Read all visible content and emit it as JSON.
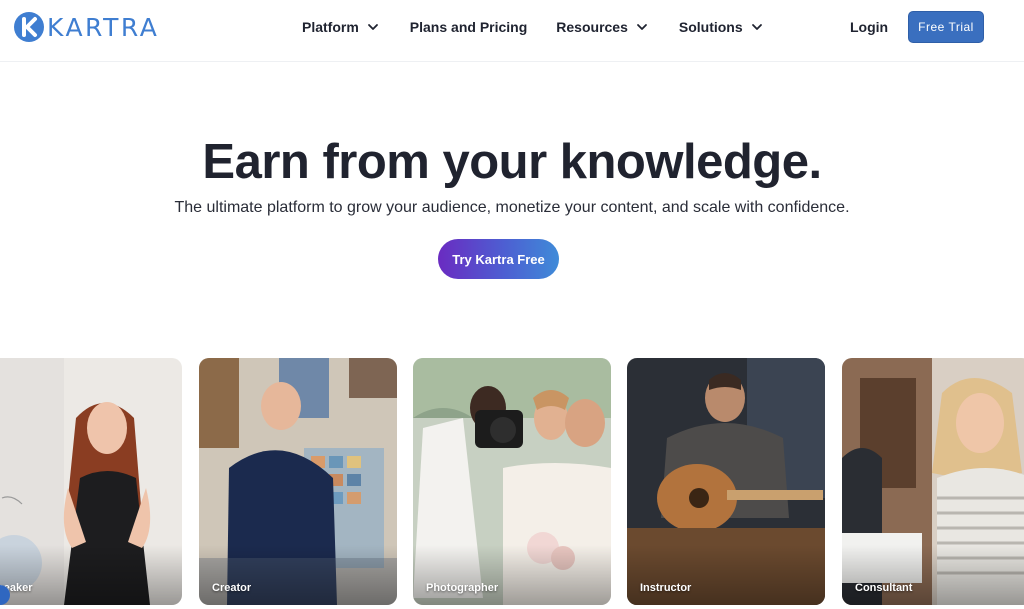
{
  "brand": {
    "name": "KARTRA",
    "accent": "#3f7ed1",
    "logo_icon": "k-logo-icon"
  },
  "nav": {
    "items": [
      {
        "label": "Platform",
        "dropdown": true
      },
      {
        "label": "Plans and Pricing",
        "dropdown": false
      },
      {
        "label": "Resources",
        "dropdown": true
      },
      {
        "label": "Solutions",
        "dropdown": true
      }
    ],
    "login_label": "Login",
    "trial_label": "Free Trial"
  },
  "hero": {
    "title": "Earn from your knowledge.",
    "subtitle": "The ultimate platform to grow your audience, monetize your content, and scale with confidence.",
    "cta_label": "Try Kartra Free",
    "cta_gradient": [
      "#6a2bc1",
      "#3f8bd8"
    ]
  },
  "cards": [
    {
      "label": "peaker"
    },
    {
      "label": "Creator"
    },
    {
      "label": "Photographer"
    },
    {
      "label": "Instructor"
    },
    {
      "label": "Consultant"
    }
  ]
}
